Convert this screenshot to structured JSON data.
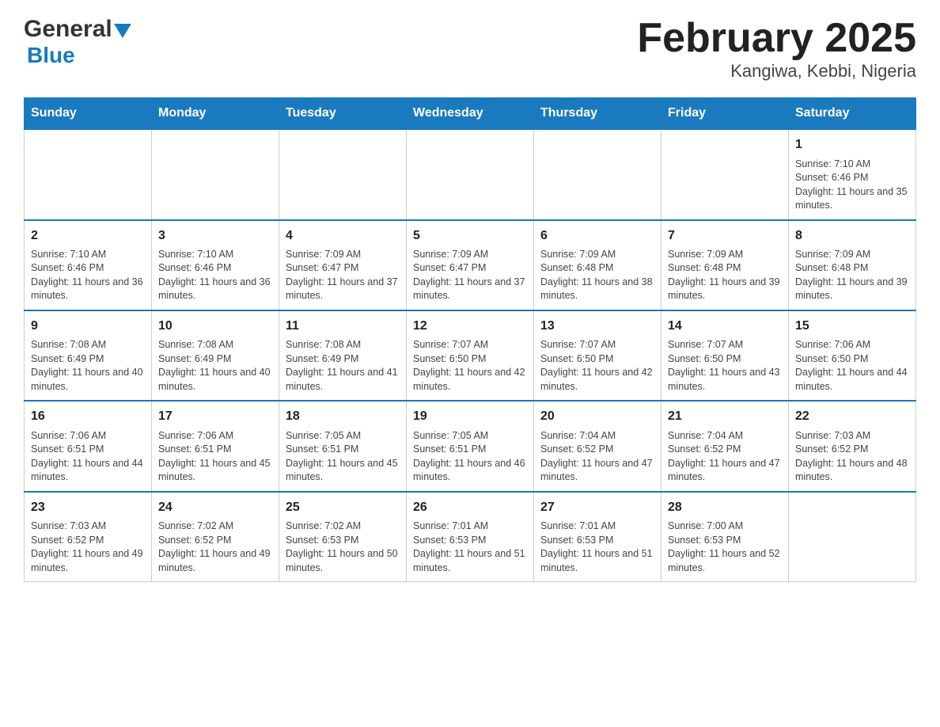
{
  "header": {
    "logo_general": "General",
    "logo_blue": "Blue",
    "title": "February 2025",
    "subtitle": "Kangiwa, Kebbi, Nigeria"
  },
  "days_of_week": [
    "Sunday",
    "Monday",
    "Tuesday",
    "Wednesday",
    "Thursday",
    "Friday",
    "Saturday"
  ],
  "weeks": [
    [
      {
        "day": "",
        "info": ""
      },
      {
        "day": "",
        "info": ""
      },
      {
        "day": "",
        "info": ""
      },
      {
        "day": "",
        "info": ""
      },
      {
        "day": "",
        "info": ""
      },
      {
        "day": "",
        "info": ""
      },
      {
        "day": "1",
        "info": "Sunrise: 7:10 AM\nSunset: 6:46 PM\nDaylight: 11 hours and 35 minutes."
      }
    ],
    [
      {
        "day": "2",
        "info": "Sunrise: 7:10 AM\nSunset: 6:46 PM\nDaylight: 11 hours and 36 minutes."
      },
      {
        "day": "3",
        "info": "Sunrise: 7:10 AM\nSunset: 6:46 PM\nDaylight: 11 hours and 36 minutes."
      },
      {
        "day": "4",
        "info": "Sunrise: 7:09 AM\nSunset: 6:47 PM\nDaylight: 11 hours and 37 minutes."
      },
      {
        "day": "5",
        "info": "Sunrise: 7:09 AM\nSunset: 6:47 PM\nDaylight: 11 hours and 37 minutes."
      },
      {
        "day": "6",
        "info": "Sunrise: 7:09 AM\nSunset: 6:48 PM\nDaylight: 11 hours and 38 minutes."
      },
      {
        "day": "7",
        "info": "Sunrise: 7:09 AM\nSunset: 6:48 PM\nDaylight: 11 hours and 39 minutes."
      },
      {
        "day": "8",
        "info": "Sunrise: 7:09 AM\nSunset: 6:48 PM\nDaylight: 11 hours and 39 minutes."
      }
    ],
    [
      {
        "day": "9",
        "info": "Sunrise: 7:08 AM\nSunset: 6:49 PM\nDaylight: 11 hours and 40 minutes."
      },
      {
        "day": "10",
        "info": "Sunrise: 7:08 AM\nSunset: 6:49 PM\nDaylight: 11 hours and 40 minutes."
      },
      {
        "day": "11",
        "info": "Sunrise: 7:08 AM\nSunset: 6:49 PM\nDaylight: 11 hours and 41 minutes."
      },
      {
        "day": "12",
        "info": "Sunrise: 7:07 AM\nSunset: 6:50 PM\nDaylight: 11 hours and 42 minutes."
      },
      {
        "day": "13",
        "info": "Sunrise: 7:07 AM\nSunset: 6:50 PM\nDaylight: 11 hours and 42 minutes."
      },
      {
        "day": "14",
        "info": "Sunrise: 7:07 AM\nSunset: 6:50 PM\nDaylight: 11 hours and 43 minutes."
      },
      {
        "day": "15",
        "info": "Sunrise: 7:06 AM\nSunset: 6:50 PM\nDaylight: 11 hours and 44 minutes."
      }
    ],
    [
      {
        "day": "16",
        "info": "Sunrise: 7:06 AM\nSunset: 6:51 PM\nDaylight: 11 hours and 44 minutes."
      },
      {
        "day": "17",
        "info": "Sunrise: 7:06 AM\nSunset: 6:51 PM\nDaylight: 11 hours and 45 minutes."
      },
      {
        "day": "18",
        "info": "Sunrise: 7:05 AM\nSunset: 6:51 PM\nDaylight: 11 hours and 45 minutes."
      },
      {
        "day": "19",
        "info": "Sunrise: 7:05 AM\nSunset: 6:51 PM\nDaylight: 11 hours and 46 minutes."
      },
      {
        "day": "20",
        "info": "Sunrise: 7:04 AM\nSunset: 6:52 PM\nDaylight: 11 hours and 47 minutes."
      },
      {
        "day": "21",
        "info": "Sunrise: 7:04 AM\nSunset: 6:52 PM\nDaylight: 11 hours and 47 minutes."
      },
      {
        "day": "22",
        "info": "Sunrise: 7:03 AM\nSunset: 6:52 PM\nDaylight: 11 hours and 48 minutes."
      }
    ],
    [
      {
        "day": "23",
        "info": "Sunrise: 7:03 AM\nSunset: 6:52 PM\nDaylight: 11 hours and 49 minutes."
      },
      {
        "day": "24",
        "info": "Sunrise: 7:02 AM\nSunset: 6:52 PM\nDaylight: 11 hours and 49 minutes."
      },
      {
        "day": "25",
        "info": "Sunrise: 7:02 AM\nSunset: 6:53 PM\nDaylight: 11 hours and 50 minutes."
      },
      {
        "day": "26",
        "info": "Sunrise: 7:01 AM\nSunset: 6:53 PM\nDaylight: 11 hours and 51 minutes."
      },
      {
        "day": "27",
        "info": "Sunrise: 7:01 AM\nSunset: 6:53 PM\nDaylight: 11 hours and 51 minutes."
      },
      {
        "day": "28",
        "info": "Sunrise: 7:00 AM\nSunset: 6:53 PM\nDaylight: 11 hours and 52 minutes."
      },
      {
        "day": "",
        "info": ""
      }
    ]
  ]
}
